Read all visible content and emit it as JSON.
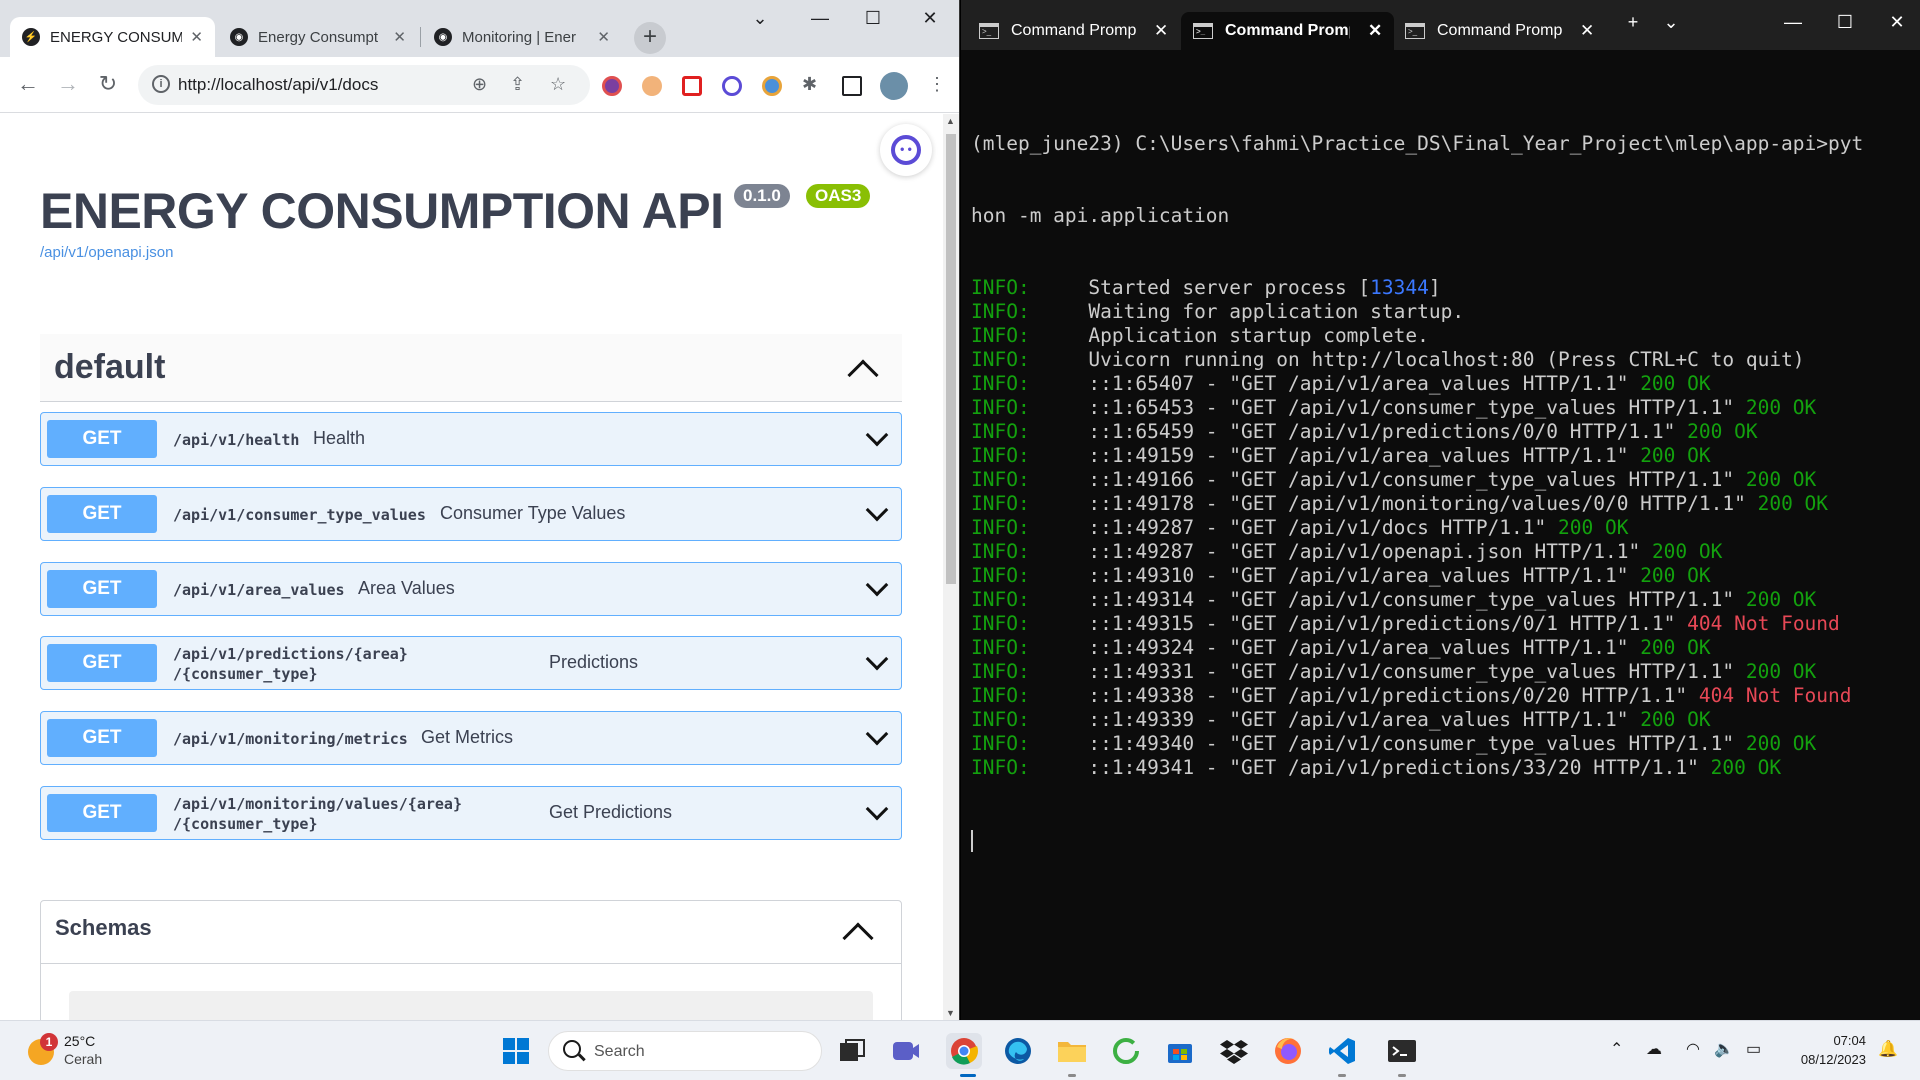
{
  "browser": {
    "tabs": [
      {
        "title": "ENERGY CONSUM",
        "active": true
      },
      {
        "title": "Energy Consumpt",
        "active": false
      },
      {
        "title": "Monitoring | Ener",
        "active": false
      }
    ],
    "url": "http://localhost/api/v1/docs"
  },
  "swagger": {
    "title": "ENERGY CONSUMPTION API",
    "version": "0.1.0",
    "oas": "OAS3",
    "openapi_link": "/api/v1/openapi.json",
    "section": "default",
    "operations": [
      {
        "method": "GET",
        "path": "/api/v1/health",
        "summary": "Health"
      },
      {
        "method": "GET",
        "path": "/api/v1/consumer_type_values",
        "summary": "Consumer Type Values"
      },
      {
        "method": "GET",
        "path": "/api/v1/area_values",
        "summary": "Area Values"
      },
      {
        "method": "GET",
        "path": "/api/v1/predictions/{area}/{consumer_type}",
        "path_line1": "/api/v1/predictions/{area}",
        "path_line2": "/{consumer_type}",
        "summary": "Predictions"
      },
      {
        "method": "GET",
        "path": "/api/v1/monitoring/metrics",
        "summary": "Get Metrics"
      },
      {
        "method": "GET",
        "path": "/api/v1/monitoring/values/{area}/{consumer_type}",
        "path_line1": "/api/v1/monitoring/values/{area}",
        "path_line2": "/{consumer_type}",
        "summary": "Get Predictions"
      }
    ],
    "schemas_label": "Schemas",
    "colors": {
      "get": "#61affe",
      "version_badge": "#89bf04",
      "title": "#3b4151"
    }
  },
  "terminal": {
    "tabs": [
      {
        "title": "Command Prompt",
        "active": false
      },
      {
        "title": "Command Prompt",
        "active": true
      },
      {
        "title": "Command Prompt",
        "active": false
      }
    ],
    "prompt_line1": "(mlep_june23) C:\\Users\\fahmi\\Practice_DS\\Final_Year_Project\\mlep\\app-api>pyt",
    "prompt_line2": "hon -m api.application",
    "log": [
      {
        "level": "INFO:",
        "msg": "     Started server process [",
        "pid": "13344",
        "tail": "]"
      },
      {
        "level": "INFO:",
        "msg": "     Waiting for application startup."
      },
      {
        "level": "INFO:",
        "msg": "     Application startup complete."
      },
      {
        "level": "INFO:",
        "msg": "     Uvicorn running on http://localhost:80 (Press CTRL+C to quit)"
      },
      {
        "level": "INFO:",
        "msg": "     ::1:65407 - \"GET /api/v1/area_values HTTP/1.1\" ",
        "status": "200 OK",
        "ok": true
      },
      {
        "level": "INFO:",
        "msg": "     ::1:65453 - \"GET /api/v1/consumer_type_values HTTP/1.1\" ",
        "status": "200 OK",
        "ok": true
      },
      {
        "level": "INFO:",
        "msg": "     ::1:65459 - \"GET /api/v1/predictions/0/0 HTTP/1.1\" ",
        "status": "200 OK",
        "ok": true
      },
      {
        "level": "INFO:",
        "msg": "     ::1:49159 - \"GET /api/v1/area_values HTTP/1.1\" ",
        "status": "200 OK",
        "ok": true
      },
      {
        "level": "INFO:",
        "msg": "     ::1:49166 - \"GET /api/v1/consumer_type_values HTTP/1.1\" ",
        "status": "200 OK",
        "ok": true
      },
      {
        "level": "INFO:",
        "msg": "     ::1:49178 - \"GET /api/v1/monitoring/values/0/0 HTTP/1.1\" ",
        "status": "200 OK",
        "ok": true
      },
      {
        "level": "INFO:",
        "msg": "     ::1:49287 - \"GET /api/v1/docs HTTP/1.1\" ",
        "status": "200 OK",
        "ok": true
      },
      {
        "level": "INFO:",
        "msg": "     ::1:49287 - \"GET /api/v1/openapi.json HTTP/1.1\" ",
        "status": "200 OK",
        "ok": true
      },
      {
        "level": "INFO:",
        "msg": "     ::1:49310 - \"GET /api/v1/area_values HTTP/1.1\" ",
        "status": "200 OK",
        "ok": true
      },
      {
        "level": "INFO:",
        "msg": "     ::1:49314 - \"GET /api/v1/consumer_type_values HTTP/1.1\" ",
        "status": "200 OK",
        "ok": true
      },
      {
        "level": "INFO:",
        "msg": "     ::1:49315 - \"GET /api/v1/predictions/0/1 HTTP/1.1\" ",
        "status": "404 Not Found",
        "ok": false
      },
      {
        "level": "INFO:",
        "msg": "     ::1:49324 - \"GET /api/v1/area_values HTTP/1.1\" ",
        "status": "200 OK",
        "ok": true
      },
      {
        "level": "INFO:",
        "msg": "     ::1:49331 - \"GET /api/v1/consumer_type_values HTTP/1.1\" ",
        "status": "200 OK",
        "ok": true
      },
      {
        "level": "INFO:",
        "msg": "     ::1:49338 - \"GET /api/v1/predictions/0/20 HTTP/1.1\" ",
        "status": "404 Not Found",
        "ok": false
      },
      {
        "level": "INFO:",
        "msg": "     ::1:49339 - \"GET /api/v1/area_values HTTP/1.1\" ",
        "status": "200 OK",
        "ok": true
      },
      {
        "level": "INFO:",
        "msg": "     ::1:49340 - \"GET /api/v1/consumer_type_values HTTP/1.1\" ",
        "status": "200 OK",
        "ok": true
      },
      {
        "level": "INFO:",
        "msg": "     ::1:49341 - \"GET /api/v1/predictions/33/20 HTTP/1.1\" ",
        "status": "200 OK",
        "ok": true
      }
    ]
  },
  "taskbar": {
    "weather_temp": "25°C",
    "weather_cond": "Cerah",
    "weather_badge": "1",
    "search_placeholder": "Search",
    "time": "07:04",
    "date": "08/12/2023",
    "icons": [
      "windows-start-icon",
      "task-view-icon",
      "meet-icon",
      "chrome-icon",
      "edge-icon",
      "file-explorer-icon",
      "refresh-app-icon",
      "store-icon",
      "dropbox-icon",
      "firefox-icon",
      "vscode-icon",
      "terminal-icon"
    ]
  }
}
